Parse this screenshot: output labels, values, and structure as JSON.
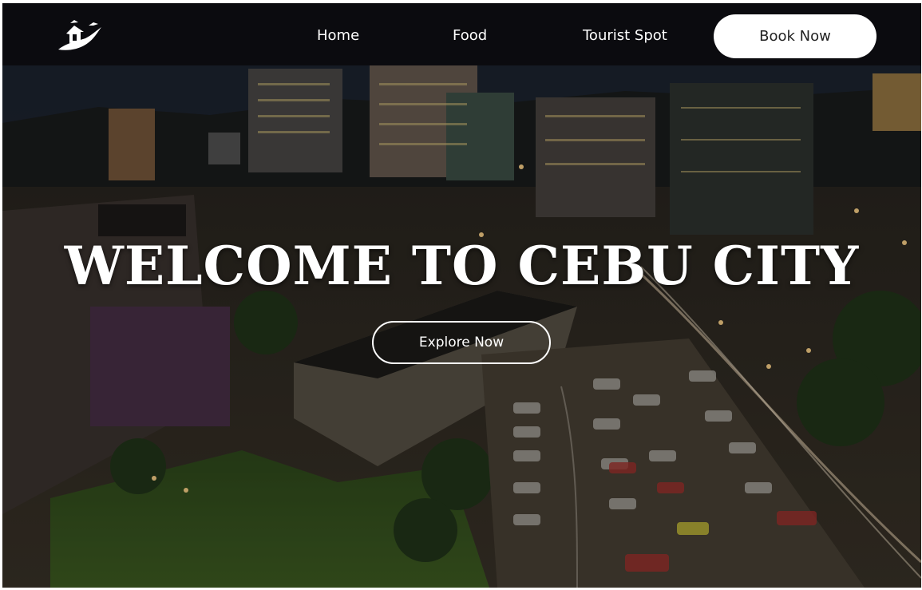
{
  "navbar": {
    "logo_icon": "house-bird-logo-icon",
    "links": [
      {
        "label": "Home"
      },
      {
        "label": "Food"
      },
      {
        "label": "Tourist Spot"
      }
    ],
    "cta_label": "Book Now"
  },
  "hero": {
    "title": "WELCOME TO CEBU CITY",
    "button_label": "Explore Now",
    "background": "night-city-aerial-photo"
  },
  "colors": {
    "navbar_bg": "#0b0b0f",
    "text": "#ffffff",
    "cta_bg": "#ffffff"
  }
}
